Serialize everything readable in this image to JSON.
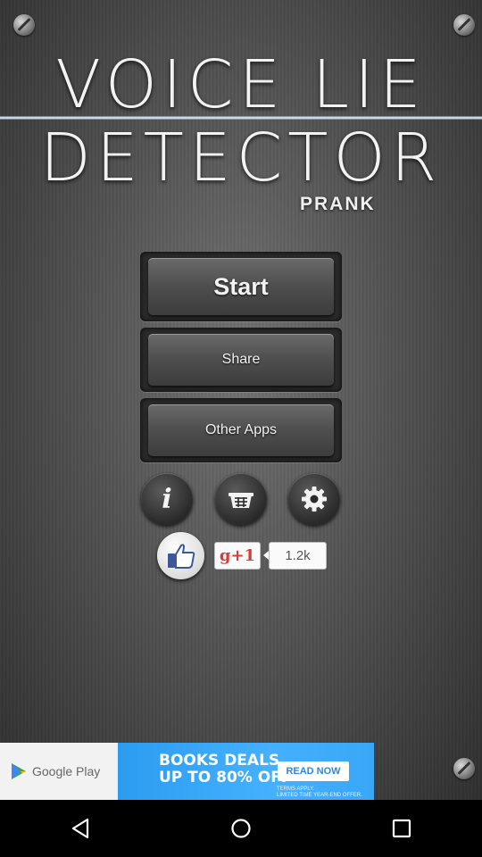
{
  "app": {
    "title_line1": "VOICE LIE",
    "title_line2": "DETECTOR",
    "subtitle": "PRANK"
  },
  "menu": {
    "start_label": "Start",
    "share_label": "Share",
    "other_apps_label": "Other Apps"
  },
  "icons": {
    "info": "info-icon",
    "shop": "basket-icon",
    "settings": "gear-icon",
    "like": "thumbs-up-icon"
  },
  "social": {
    "gplus_label": "g+1",
    "count": "1.2k"
  },
  "ad": {
    "store_label": "Google Play",
    "headline_line1": "BOOKS DEALS",
    "headline_line2": "UP TO 80% OFF",
    "cta": "READ NOW",
    "terms_line1": "TERMS APPLY.",
    "terms_line2": "LIMITED TIME YEAR-END OFFER."
  },
  "colors": {
    "accent_wave": "#3aa0ff",
    "ad_blue": "#2b9cf0",
    "gplus_red": "#d73d32"
  },
  "navbar": {
    "back": "back-icon",
    "home": "home-icon",
    "recents": "recents-icon"
  }
}
